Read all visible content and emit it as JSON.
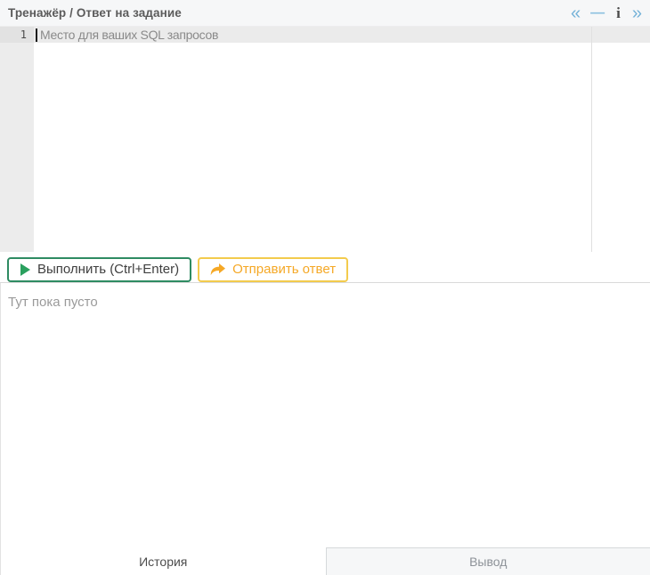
{
  "header": {
    "title": "Тренажёр / Ответ на задание",
    "icons": {
      "collapse_left": "«",
      "minimize": "—",
      "info": "i",
      "expand_right": "»"
    }
  },
  "editor": {
    "line_number": "1",
    "placeholder": "Место для ваших SQL запросов"
  },
  "toolbar": {
    "run_label": "Выполнить (Ctrl+Enter)",
    "submit_label": "Отправить ответ"
  },
  "results": {
    "empty_text": "Тут пока пусто"
  },
  "tabs": [
    {
      "label": "История",
      "active": true
    },
    {
      "label": "Вывод",
      "active": false
    }
  ],
  "colors": {
    "run_green_border": "#2e8b62",
    "run_green_icon": "#2aa05e",
    "submit_yellow_border": "#f3cb4d",
    "submit_orange": "#f5a826",
    "chevron_blue": "#74b2d8",
    "active_line_bg": "#ebebeb",
    "gutter_bg": "#ececec"
  }
}
